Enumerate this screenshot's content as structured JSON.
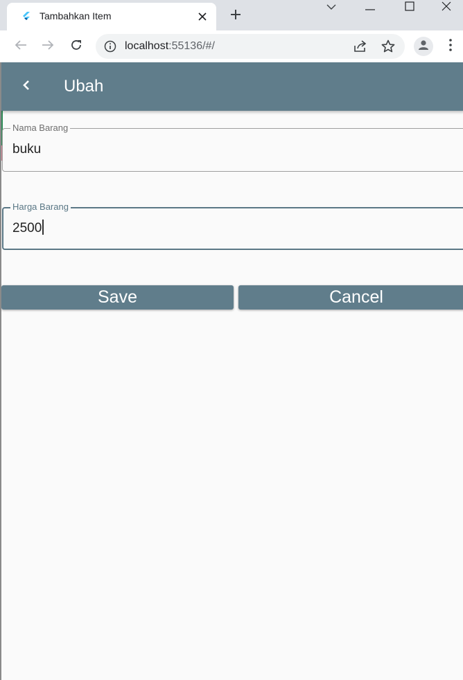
{
  "browser": {
    "tab_title": "Tambahkan Item",
    "url_host": "localhost",
    "url_rest": ":55136/#/",
    "icons": {
      "favicon": "flutter-logo-icon",
      "tab_close": "close-icon",
      "new_tab": "plus-icon",
      "tab_search": "chevron-down-icon",
      "minimize": "minimize-icon",
      "maximize": "maximize-icon",
      "close_window": "close-icon",
      "back": "arrow-left-icon",
      "forward": "arrow-right-icon",
      "reload": "reload-icon",
      "site_info": "info-icon",
      "share": "share-icon",
      "bookmark": "star-icon",
      "profile": "person-icon",
      "menu": "kebab-menu-icon"
    }
  },
  "app": {
    "appbar_title": "Ubah",
    "form": {
      "name_label": "Nama Barang",
      "name_value": "buku",
      "price_label": "Harga Barang",
      "price_value": "2500"
    },
    "buttons": {
      "save": "Save",
      "cancel": "Cancel"
    },
    "colors": {
      "primary": "#607d8b",
      "background": "#fafafa",
      "focused_border": "#5a7785",
      "idle_border": "#9e9e9e",
      "side_accent_green": "#2e8b57",
      "side_accent_pink": "#d98b9a"
    }
  }
}
